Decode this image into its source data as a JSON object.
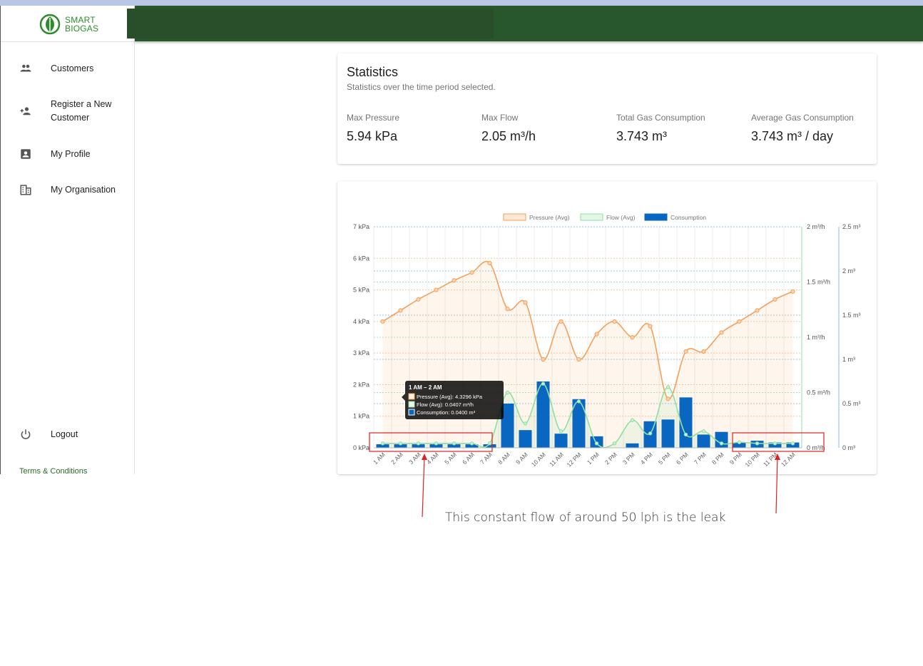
{
  "app": {
    "logo_line1": "SMART",
    "logo_line2": "BIOGAS"
  },
  "sidebar": {
    "items": [
      {
        "label": "Customers",
        "icon": "people-icon"
      },
      {
        "label_line1": "Register a New",
        "label_line2": "Customer",
        "icon": "person-add-icon"
      },
      {
        "label": "My Profile",
        "icon": "contact-card-icon"
      },
      {
        "label": "My Organisation",
        "icon": "building-icon"
      }
    ],
    "logout": "Logout",
    "terms": "Terms & Conditions"
  },
  "statistics": {
    "title": "Statistics",
    "subtitle": "Statistics over the time period selected.",
    "items": [
      {
        "label": "Max Pressure",
        "value": "5.94 kPa"
      },
      {
        "label": "Max Flow",
        "value": "2.05 m³/h"
      },
      {
        "label": "Total Gas Consumption",
        "value": "3.743 m³"
      },
      {
        "label": "Average Gas Consumption",
        "value": "3.743 m³ / day"
      }
    ]
  },
  "tooltip": {
    "title": "1 AM – 2 AM",
    "lines": [
      "Pressure (Avg): 4.3296 kPa",
      "Flow (Avg): 0.0407 m³/h",
      "Consumption: 0.0400 m³"
    ]
  },
  "annotation": "This constant flow of around 50 lph is the leak",
  "colors": {
    "header": "#27572a",
    "pressure": "#f5a05a",
    "flow": "#8fe0a0",
    "consumption": "#0967c2",
    "highlight": "#e02020"
  },
  "chart_data": {
    "type": "bar",
    "legend_position": "top",
    "categories": [
      "1 AM",
      "2 AM",
      "3 AM",
      "4 AM",
      "5 AM",
      "6 AM",
      "7 AM",
      "8 AM",
      "9 AM",
      "10 AM",
      "11 AM",
      "12 PM",
      "1 PM",
      "2 PM",
      "3 PM",
      "4 PM",
      "5 PM",
      "6 PM",
      "7 PM",
      "8 PM",
      "9 PM",
      "10 PM",
      "11 PM",
      "12 AM"
    ],
    "series": [
      {
        "name": "Pressure (Avg)",
        "type": "line",
        "axis": "pressure",
        "values": [
          4.0,
          4.35,
          4.7,
          5.0,
          5.3,
          5.55,
          5.85,
          4.4,
          4.6,
          2.8,
          4.0,
          2.8,
          3.6,
          4.0,
          3.5,
          3.85,
          1.55,
          3.05,
          3.05,
          3.65,
          4.0,
          4.35,
          4.7,
          4.95
        ]
      },
      {
        "name": "Flow (Avg)",
        "type": "line",
        "axis": "flow",
        "values": [
          0.04,
          0.04,
          0.04,
          0.04,
          0.04,
          0.04,
          0.04,
          0.5,
          0.22,
          0.58,
          0.15,
          0.42,
          0.04,
          0.04,
          0.25,
          0.13,
          0.55,
          0.12,
          0.15,
          0.04,
          0.05,
          0.04,
          0.04,
          0.04
        ]
      },
      {
        "name": "Consumption",
        "type": "bar",
        "axis": "consumption",
        "values": [
          0.04,
          0.04,
          0.04,
          0.04,
          0.04,
          0.04,
          0.04,
          0.5,
          0.2,
          0.75,
          0.16,
          0.55,
          0.13,
          0.0,
          0.05,
          0.3,
          0.32,
          0.57,
          0.15,
          0.18,
          0.06,
          0.08,
          0.06,
          0.06
        ]
      }
    ],
    "axes": {
      "pressure": {
        "ticks": [
          "0 kPa",
          "1 kPa",
          "2 kPa",
          "3 kPa",
          "4 kPa",
          "5 kPa",
          "6 kPa",
          "7 kPa"
        ],
        "range": [
          0,
          7
        ]
      },
      "flow": {
        "ticks": [
          "0 m³/h",
          "0.5 m³/h",
          "1 m³/h",
          "1.5 m³/h",
          "2 m³/h"
        ],
        "range": [
          0,
          2
        ]
      },
      "consumption": {
        "ticks": [
          "0 m³",
          "0.5 m³",
          "1 m³",
          "1.5 m³",
          "2 m³",
          "2.5 m³"
        ],
        "range": [
          0,
          2.5
        ]
      }
    },
    "grid": true
  }
}
